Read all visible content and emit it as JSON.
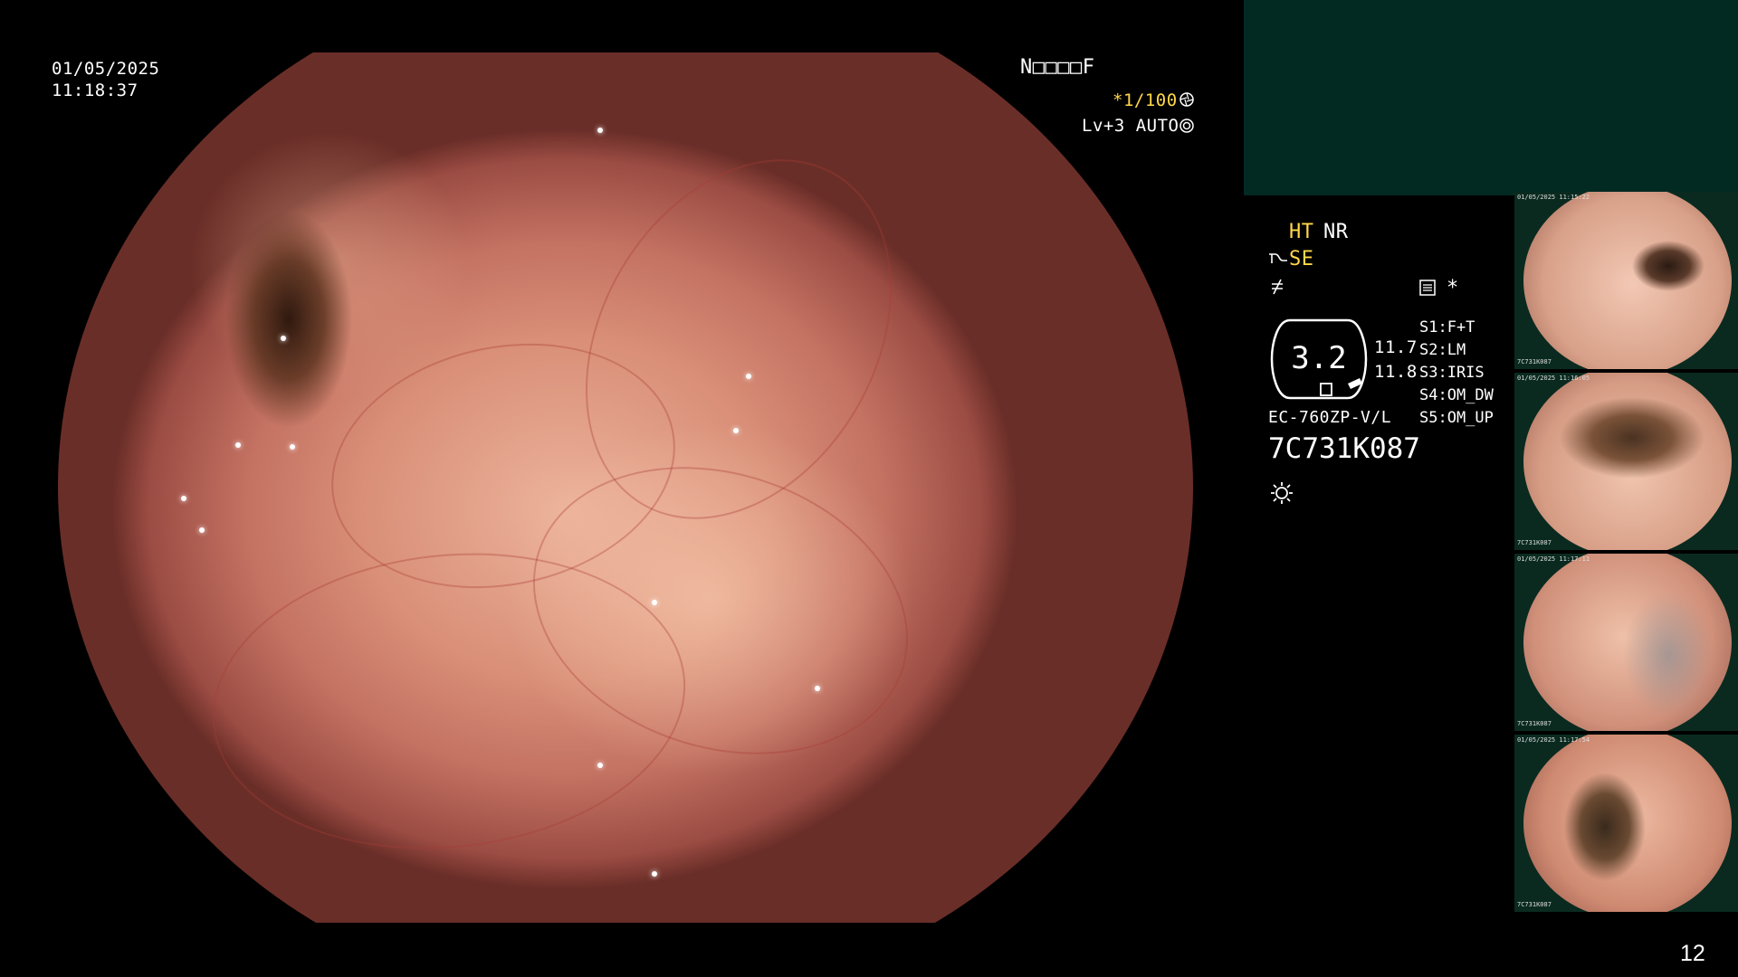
{
  "overlay": {
    "date": "01/05/2025",
    "time": "11:18:37",
    "patient_code": "N□□□□F",
    "shutter": "*1/100",
    "level": "Lv+3 AUTO",
    "frame_number": "12"
  },
  "settings": {
    "ht": "HT",
    "nr": "NR",
    "se": "SE",
    "zoom_value": "3.2",
    "value_1": "11.7",
    "value_2": "11.8",
    "switches": [
      "S1:F+T",
      "S2:LM",
      "S3:IRIS",
      "S4:OM_DW",
      "S5:OM_UP"
    ],
    "asterisk": "*",
    "scope_model": "EC-760ZP-V/L",
    "serial": "7C731K087"
  },
  "thumbnails": [
    {
      "caption_top": "01/05/2025 11:15:22",
      "caption_bottom": "7C731K087"
    },
    {
      "caption_top": "01/05/2025 11:16:05",
      "caption_bottom": "7C731K087"
    },
    {
      "caption_top": "01/05/2025 11:17:11",
      "caption_bottom": "7C731K087"
    },
    {
      "caption_top": "01/05/2025 11:17:54",
      "caption_bottom": "7C731K087"
    }
  ],
  "icons": {
    "shutter_icon": "aperture-icon",
    "level_icon": "iris-icon",
    "se_icon": "structure-enhance-icon",
    "filter_icon": "filter-icon",
    "doc_icon": "document-icon",
    "light_icon": "sun-icon"
  },
  "colors": {
    "accent_yellow": "#ffd84a",
    "panel_dark_green": "#032a22"
  }
}
